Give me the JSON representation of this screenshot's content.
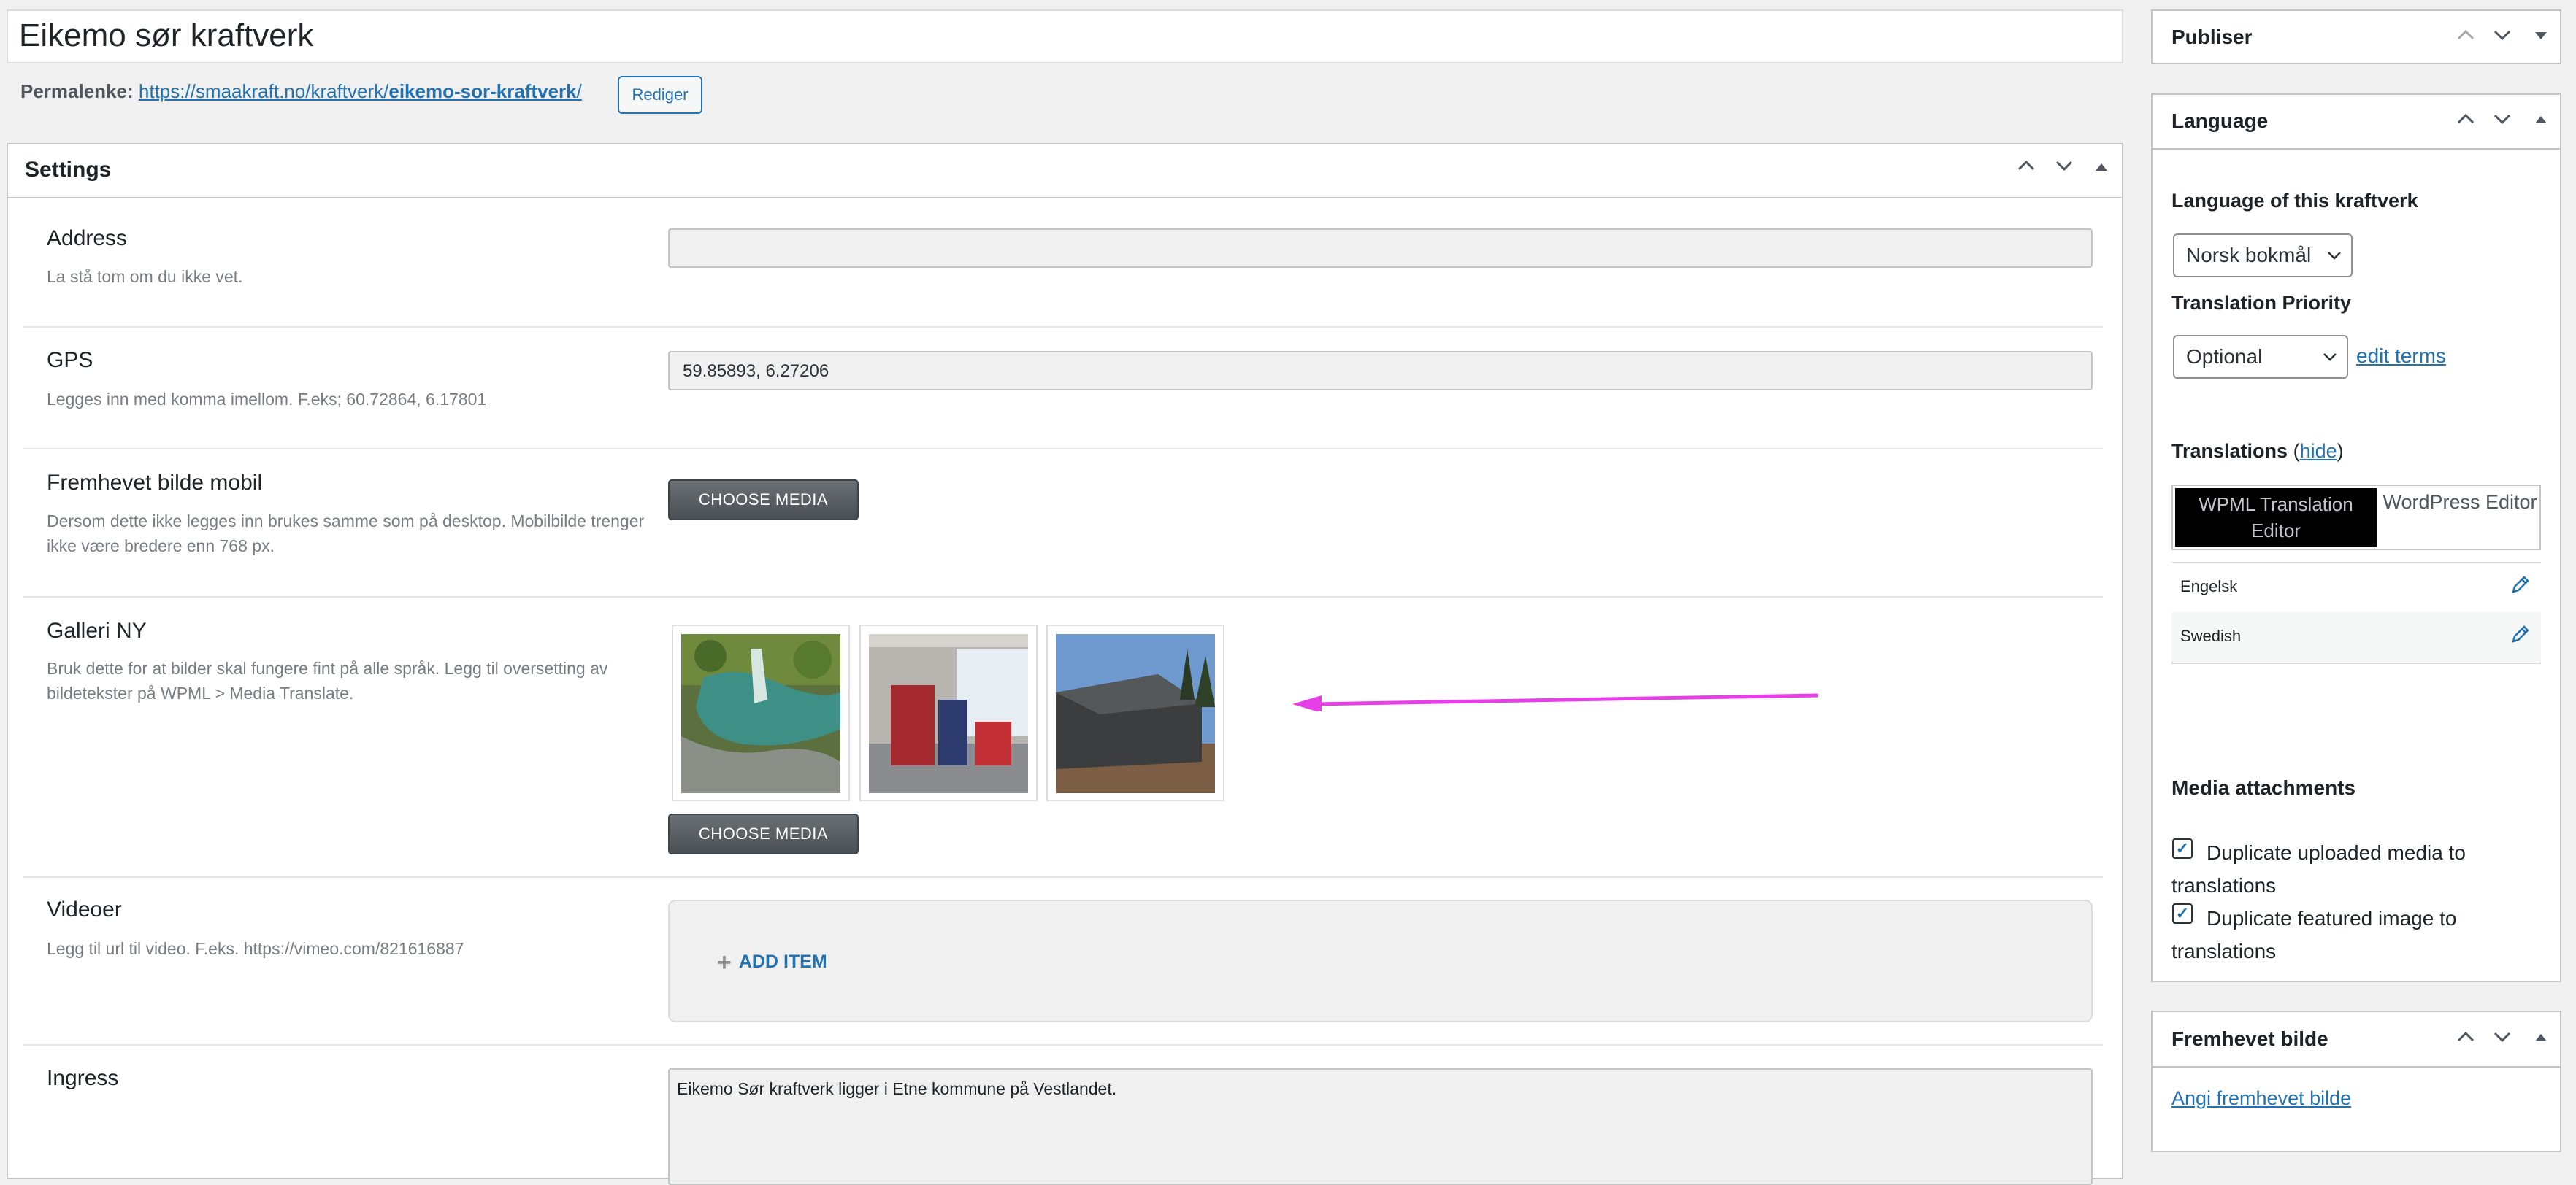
{
  "post": {
    "title": "Eikemo sør kraftverk",
    "permalink_label": "Permalenke:",
    "permalink_url_base": "https://smaakraft.no/kraftverk/",
    "permalink_slug": "eikemo-sor-kraftverk",
    "permalink_url_tail": "/",
    "permalink_edit_label": "Rediger"
  },
  "settings": {
    "title": "Settings",
    "address": {
      "label": "Address",
      "desc": "La stå tom om du ikke vet.",
      "value": ""
    },
    "gps": {
      "label": "GPS",
      "desc": "Legges inn med komma imellom. F.eks; 60.72864, 6.17801",
      "value": "59.85893, 6.27206"
    },
    "featured_mobile": {
      "label": "Fremhevet bilde mobil",
      "desc": "Dersom dette ikke legges inn brukes samme som på desktop. Mobilbilde trenger ikke være bredere enn 768 px.",
      "button": "CHOOSE MEDIA"
    },
    "gallery": {
      "label": "Galleri NY",
      "desc": "Bruk dette for at bilder skal fungere fint på alle språk. Legg til oversetting av bildetekster på WPML > Media Translate.",
      "button": "CHOOSE MEDIA"
    },
    "videos": {
      "label": "Videoer",
      "desc": "Legg til url til video. F.eks. https://vimeo.com/821616887",
      "add_item": "ADD ITEM"
    },
    "ingress": {
      "label": "Ingress",
      "value": "Eikemo Sør kraftverk ligger i Etne kommune på Vestlandet."
    }
  },
  "sidebar": {
    "publish": {
      "title": "Publiser"
    },
    "language": {
      "title": "Language",
      "lang_label": "Language of this kraftverk",
      "lang_value": "Norsk bokmål",
      "priority_label": "Translation Priority",
      "priority_value": "Optional",
      "edit_terms": "edit terms",
      "translations_label": "Translations",
      "hide_paren_open": "(",
      "hide": "hide",
      "hide_paren_close": ")",
      "tab_wpml": "WPML Translation Editor",
      "tab_wp": "WordPress Editor",
      "translations": [
        {
          "lang": "Engelsk"
        },
        {
          "lang": "Swedish"
        }
      ],
      "media_title": "Media attachments",
      "dup_media": "Duplicate uploaded media to translations",
      "dup_featured": "Duplicate featured image to translations"
    },
    "featured": {
      "title": "Fremhevet bilde",
      "link": "Angi fremhevet bilde"
    }
  },
  "icons": {
    "up": "chevron-up-icon",
    "down": "chevron-down-icon",
    "toggle": "triangle-up-icon",
    "pencil": "pencil-icon",
    "plus": "plus-icon",
    "check": "checkmark-icon"
  },
  "colors": {
    "accent": "#2271b1",
    "annotation_arrow": "#e83ee8"
  }
}
